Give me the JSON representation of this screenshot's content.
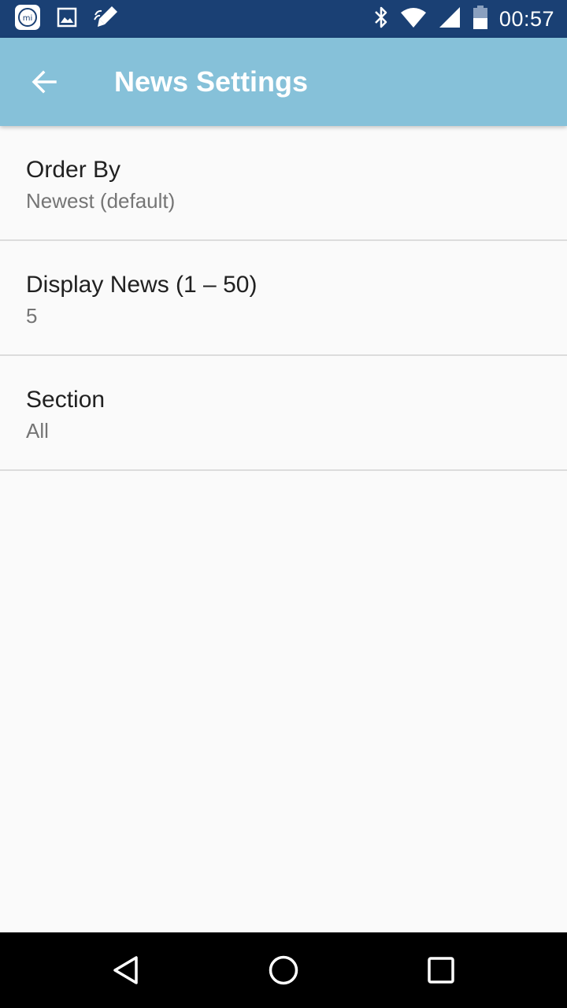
{
  "status_bar": {
    "time": "00:57",
    "icons": [
      "mi-app-icon",
      "gallery-icon",
      "pen-notification-icon",
      "bluetooth-icon",
      "wifi-icon",
      "cell-signal-icon",
      "battery-icon"
    ],
    "color": "#1a4074"
  },
  "app_bar": {
    "title": "News Settings",
    "back_icon": "arrow-back-icon",
    "color": "#86c1d9"
  },
  "preferences": [
    {
      "title": "Order By",
      "summary": "Newest (default)"
    },
    {
      "title": "Display News (1 – 50)",
      "summary": "5"
    },
    {
      "title": "Section",
      "summary": "All"
    }
  ],
  "nav_bar": {
    "icons": [
      "back-triangle-icon",
      "home-circle-icon",
      "recents-square-icon"
    ]
  }
}
